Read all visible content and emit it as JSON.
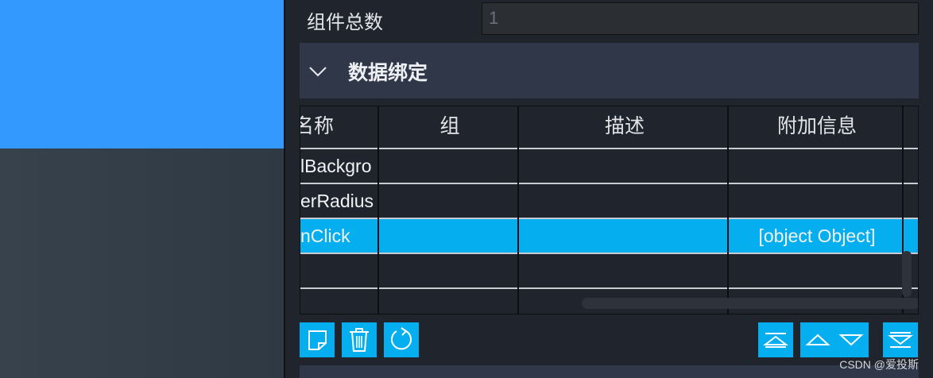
{
  "colors": {
    "canvas_blue": "#3399ff",
    "panel_bg": "#20242c",
    "section_bg": "#303749",
    "selected_row": "#05aeee",
    "button": "#05aeee"
  },
  "properties": {
    "component_count_label": "组件总数",
    "component_count_value": "1"
  },
  "section": {
    "title": "数据绑定",
    "icon": "chevron-down-icon"
  },
  "table": {
    "columns": [
      "名称",
      "组",
      "描述",
      "附加信息"
    ],
    "rows": [
      {
        "name": "lBackgro",
        "group": "",
        "description": "",
        "extra": ""
      },
      {
        "name": "erRadius",
        "group": "",
        "description": "",
        "extra": ""
      },
      {
        "name": "nClick",
        "group": "",
        "description": "",
        "extra": "[object Object]",
        "selected": true
      },
      {
        "name": "",
        "group": "",
        "description": "",
        "extra": ""
      }
    ]
  },
  "toolbar": {
    "left_buttons": [
      "new-icon",
      "trash-icon",
      "refresh-icon"
    ],
    "right_buttons": [
      "move-top-icon",
      "move-up-icon",
      "move-down-icon",
      "move-bottom-icon"
    ]
  },
  "watermark": "CSDN @爱投斯"
}
